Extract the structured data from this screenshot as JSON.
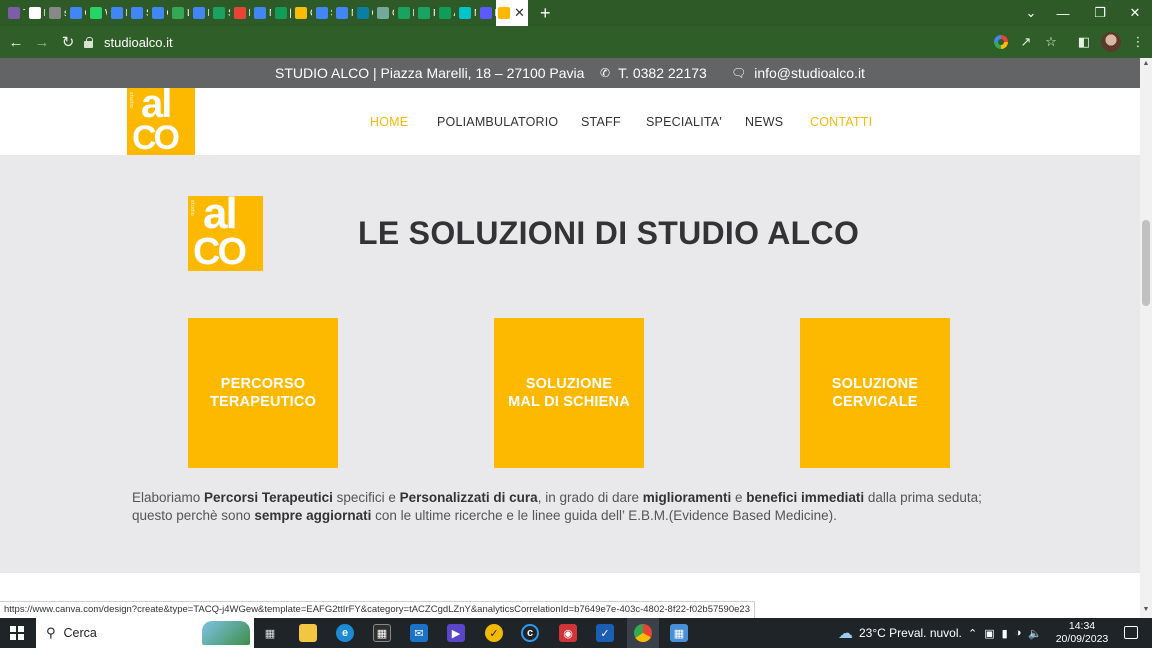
{
  "browser": {
    "tabs": [
      {
        "label": "Th",
        "icon": "email-icon",
        "color": "#7b5ea7"
      },
      {
        "label": "M",
        "icon": "wikipedia-icon",
        "color": "#ffffff"
      },
      {
        "label": "sc",
        "icon": "globe-icon",
        "color": "#888888"
      },
      {
        "label": "Cu",
        "icon": "docs-icon",
        "color": "#4285f4"
      },
      {
        "label": "W",
        "icon": "whatsapp-icon",
        "color": "#25d366"
      },
      {
        "label": "La",
        "icon": "docs-icon",
        "color": "#4285f4"
      },
      {
        "label": "Sc",
        "icon": "docs-icon",
        "color": "#4285f4"
      },
      {
        "label": "Gi",
        "icon": "docs-icon",
        "color": "#4285f4"
      },
      {
        "label": "Lo",
        "icon": "dollar-icon",
        "color": "#34a853"
      },
      {
        "label": "Le",
        "icon": "docs-icon",
        "color": "#4285f4"
      },
      {
        "label": "Sc",
        "icon": "leaf-icon",
        "color": "#1aa260"
      },
      {
        "label": "Pi",
        "icon": "gmail-icon",
        "color": "#ea4335"
      },
      {
        "label": "M",
        "icon": "docs-icon",
        "color": "#4285f4"
      },
      {
        "label": "[D",
        "icon": "sheets-plus-icon",
        "color": "#0f9d58"
      },
      {
        "label": "Cl",
        "icon": "drive-icon",
        "color": "#fbbc05"
      },
      {
        "label": "Sc",
        "icon": "docs-icon",
        "color": "#4285f4"
      },
      {
        "label": "M",
        "icon": "docs-icon",
        "color": "#4285f4"
      },
      {
        "label": "Cl",
        "icon": "cloud-icon",
        "color": "#0a7ea4"
      },
      {
        "label": "Cl",
        "icon": "chatgpt-icon",
        "color": "#74aa9c"
      },
      {
        "label": "Fi",
        "icon": "leaf-icon",
        "color": "#1aa260"
      },
      {
        "label": "Fi",
        "icon": "leaf-icon",
        "color": "#1aa260"
      },
      {
        "label": "Ar",
        "icon": "sheets-plus-icon",
        "color": "#0f9d58"
      },
      {
        "label": "M",
        "icon": "canva-icon",
        "color": "#00c4cc"
      },
      {
        "label": "Bl",
        "icon": "bing-icon",
        "color": "#5a5aff"
      }
    ],
    "active_tab_icon": "studio-alco-icon",
    "new_tab_label": "+",
    "url": "studioalco.it",
    "status_url": "https://www.canva.com/design?create&type=TACQ-j4WGew&template=EAFG2ttIrFY&category=tACZCgdLZnY&analyticsCorrelationId=b7649e7e-403c-4802-8f22-f02b57590e23"
  },
  "site": {
    "top_strip": {
      "address": "STUDIO ALCO | Piazza Marelli, 18 – 27100 Pavia",
      "phone": "T. 0382 22173",
      "email": "info@studioalco.it"
    },
    "logo": {
      "al": "al",
      "co": "CO",
      "side": "studio"
    },
    "nav": [
      {
        "label": "HOME",
        "active": true
      },
      {
        "label": "POLIAMBULATORIO",
        "active": false
      },
      {
        "label": "STAFF",
        "active": false
      },
      {
        "label": "SPECIALITA'",
        "active": false
      },
      {
        "label": "NEWS",
        "active": false
      },
      {
        "label": "CONTATTI",
        "active": true
      }
    ],
    "headline": "LE SOLUZIONI DI STUDIO ALCO",
    "cards": [
      {
        "line1": "PERCORSO",
        "line2": "TERAPEUTICO"
      },
      {
        "line1": "SOLUZIONE",
        "line2": "MAL DI SCHIENA"
      },
      {
        "line1": "SOLUZIONE",
        "line2": "CERVICALE"
      }
    ],
    "body": {
      "p1": "Elaboriamo ",
      "b1": "Percorsi Terapeutici",
      "p2": " specifici e ",
      "b2": "Personalizzati di cura",
      "p3": ", in grado di dare ",
      "b3": "miglioramenti",
      "p4": " e ",
      "b4": "benefici immediati",
      "p5": " dalla prima seduta; questo perchè sono ",
      "b5": "sempre aggiornati",
      "p6": " con le ultime ricerche e le linee guida dell’ E.B.M.(Evidence Based Medicine)."
    },
    "colors": {
      "accent": "#fcb900",
      "strip": "#636466",
      "section_bg": "#e9e9ec"
    }
  },
  "taskbar": {
    "search_placeholder": "Cerca",
    "weather": "23°C  Preval. nuvol.",
    "time": "14:34",
    "date": "20/09/2023",
    "apps": [
      "task-view-icon",
      "file-explorer-icon",
      "edge-icon",
      "store-icon",
      "mail-icon",
      "app-icon",
      "norton-icon",
      "cortana-icon",
      "video-icon",
      "defender-icon",
      "chrome-icon",
      "calculator-icon"
    ]
  }
}
